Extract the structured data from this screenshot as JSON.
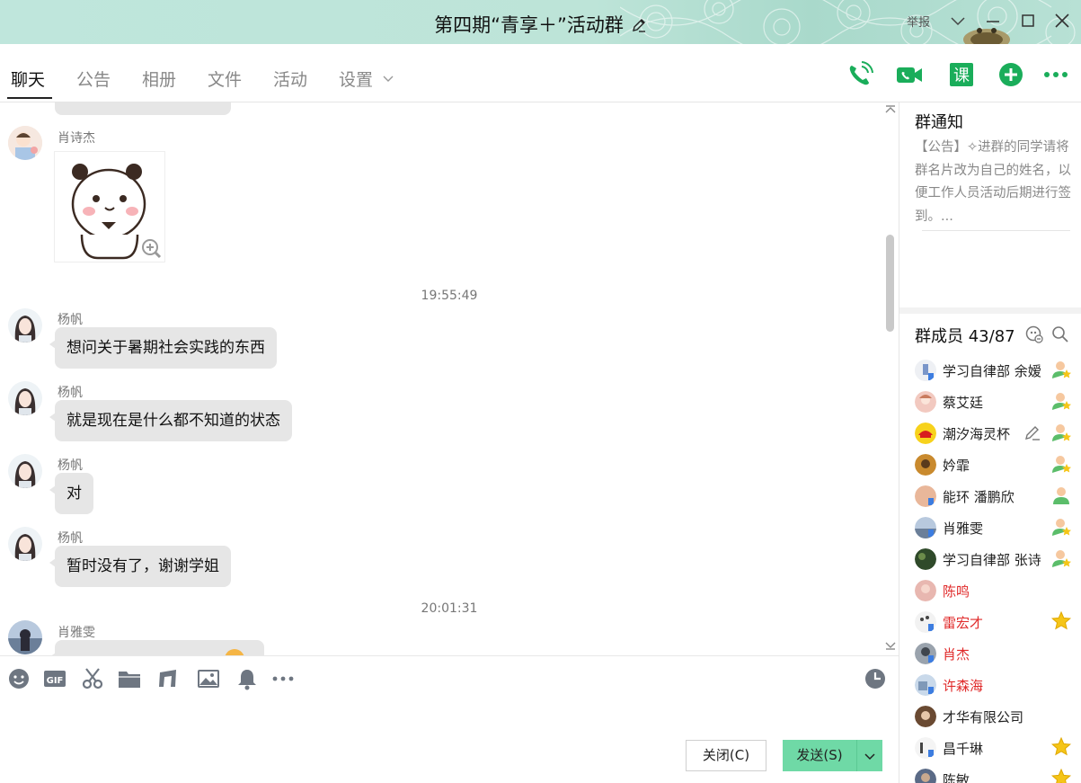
{
  "window": {
    "title": "第四期“青享＋”活动群",
    "report_label": "举报"
  },
  "tabs": [
    {
      "label": "聊天",
      "active": true
    },
    {
      "label": "公告"
    },
    {
      "label": "相册"
    },
    {
      "label": "文件"
    },
    {
      "label": "活动"
    },
    {
      "label": "设置"
    }
  ],
  "toolbar_icons": [
    "phone-call-icon",
    "video-call-icon",
    "course-icon",
    "add-app-icon",
    "more-icon"
  ],
  "toolbar": {
    "course_glyph": "课"
  },
  "chat": {
    "messages": [
      {
        "sender": "肖诗杰",
        "type": "sticker"
      },
      {
        "timestamp": "19:55:49"
      },
      {
        "sender": "杨帆",
        "text": "想问关于暑期社会实践的东西"
      },
      {
        "sender": "杨帆",
        "text": "就是现在是什么都不知道的状态"
      },
      {
        "sender": "杨帆",
        "text": "对"
      },
      {
        "sender": "杨帆",
        "text": "暂时没有了，谢谢学姐"
      },
      {
        "timestamp": "20:01:31"
      },
      {
        "sender": "肖雅雯",
        "text": ""
      }
    ]
  },
  "input": {
    "icons": [
      "emoji-icon",
      "gif-icon",
      "screenshot-icon",
      "folder-icon",
      "music-icon",
      "image-icon",
      "bell-icon",
      "more-icon",
      "history-icon"
    ],
    "gif_label": "GIF",
    "close_label": "关闭(C)",
    "send_label": "发送(S)"
  },
  "notice": {
    "title": "群通知",
    "text": "【公告】✧进群的同学请将群名片改为自己的姓名，以便工作人员活动后期进行签到。..."
  },
  "members": {
    "title": "群成员 43/87",
    "list": [
      {
        "name": "学习自律部  余嫒",
        "badge": "admin-star",
        "color": "normal"
      },
      {
        "name": "蔡艾廷",
        "badge": "admin-star",
        "color": "normal"
      },
      {
        "name": "潮汐海灵杯",
        "badge": "admin-star",
        "color": "normal",
        "edit": true
      },
      {
        "name": "妗霏",
        "badge": "admin-star",
        "color": "normal"
      },
      {
        "name": "能环  潘鹏欣",
        "badge": "admin",
        "color": "normal"
      },
      {
        "name": "肖雅雯",
        "badge": "admin-star",
        "color": "normal"
      },
      {
        "name": "学习自律部 张诗",
        "badge": "admin-star",
        "color": "normal"
      },
      {
        "name": "陈鸣",
        "badge": "",
        "color": "red"
      },
      {
        "name": "雷宏才",
        "badge": "star",
        "color": "red"
      },
      {
        "name": "肖杰",
        "badge": "",
        "color": "red"
      },
      {
        "name": "许森海",
        "badge": "",
        "color": "red"
      },
      {
        "name": "才华有限公司",
        "badge": "",
        "color": "normal"
      },
      {
        "name": "昌千琳",
        "badge": "star",
        "color": "normal"
      },
      {
        "name": "陈敏",
        "badge": "star",
        "color": "normal"
      }
    ]
  },
  "colors": {
    "accent_green": "#1aad5a",
    "send_button": "#6fd9a6",
    "title_bar": "#bde4d8",
    "member_red": "#e02a2a"
  }
}
